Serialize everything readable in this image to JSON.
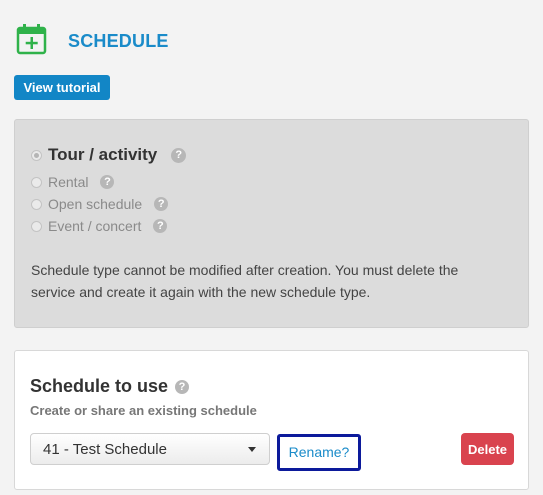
{
  "header": {
    "title": "SCHEDULE",
    "icon": "calendar-add-icon",
    "icon_color": "#2fb24a",
    "title_color": "#1a8bc9"
  },
  "tutorial_button": {
    "label": "View tutorial",
    "color": "#1286c6"
  },
  "schedule_type": {
    "options": [
      {
        "label": "Tour / activity",
        "selected": true
      },
      {
        "label": "Rental",
        "selected": false
      },
      {
        "label": "Open schedule",
        "selected": false
      },
      {
        "label": "Event / concert",
        "selected": false
      }
    ],
    "help_icon_glyph": "?",
    "notice": "Schedule type cannot be modified after creation. You must delete the service and create it again with the new schedule type."
  },
  "schedule_to_use": {
    "title": "Schedule to use",
    "subtitle": "Create or share an existing schedule",
    "selected_value": "41 - Test Schedule",
    "rename_label": "Rename?",
    "delete_label": "Delete",
    "delete_color": "#d9434e"
  }
}
